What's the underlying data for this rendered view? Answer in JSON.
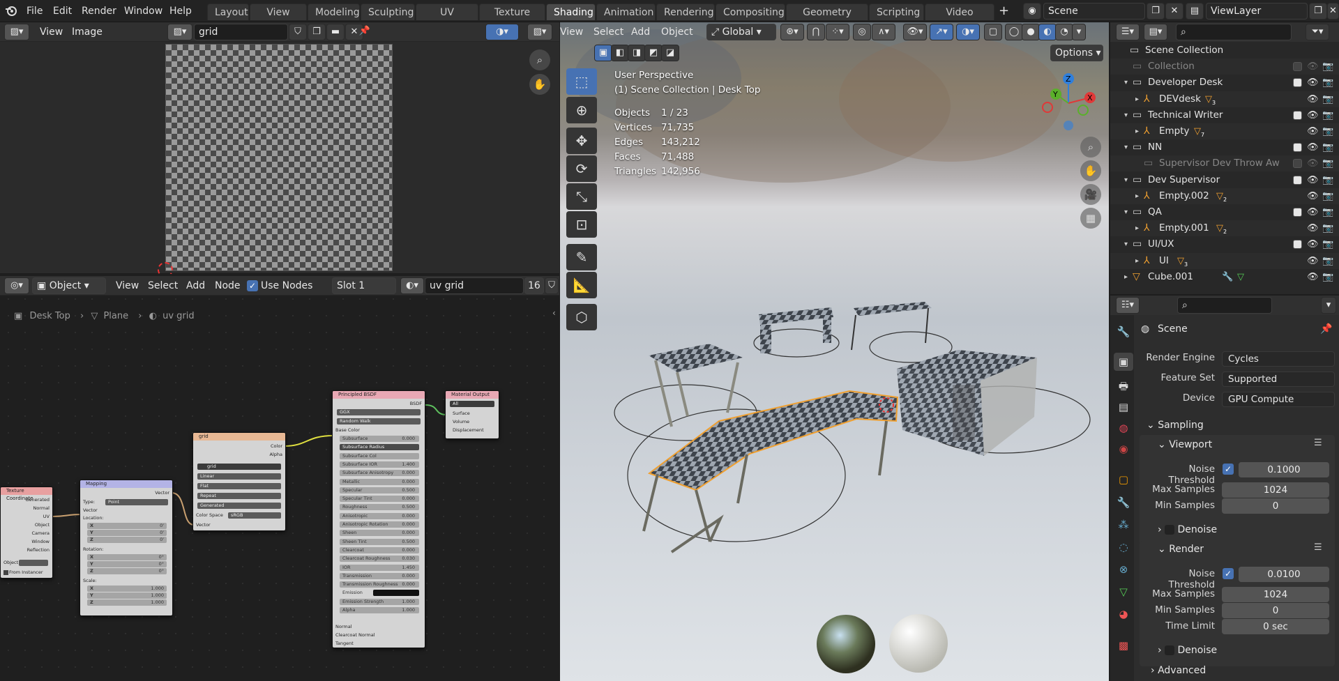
{
  "topbar": {
    "menus": [
      "File",
      "Edit",
      "Render",
      "Window",
      "Help"
    ],
    "workspaces": [
      "Layout",
      "View Port",
      "Modeling",
      "Sculpting",
      "UV Editing",
      "Texture Paint",
      "Shading",
      "Animation",
      "Rendering",
      "Compositing",
      "Geometry Nodes",
      "Scripting",
      "Video Editing"
    ],
    "active_workspace": "Shading",
    "add_tab": "+",
    "scene": "Scene",
    "view_layer": "ViewLayer"
  },
  "image_editor": {
    "menus": [
      "View",
      "Image"
    ],
    "image_name": "grid"
  },
  "node_editor": {
    "object_mode": "Object",
    "menus": [
      "View",
      "Select",
      "Add",
      "Node"
    ],
    "use_nodes_label": "Use Nodes",
    "slot": "Slot 1",
    "material": "uv grid",
    "user_count": "16",
    "breadcrumb": [
      "Desk Top",
      "Plane",
      "uv grid"
    ],
    "nodes": {
      "texcoord": {
        "title": "Texture Coordinate",
        "outputs": [
          "Generated",
          "Normal",
          "UV",
          "Object",
          "Camera",
          "Window",
          "Reflection"
        ],
        "object_label": "Object",
        "from_instancer": "From Instancer"
      },
      "mapping": {
        "title": "Mapping",
        "vector_out": "Vector",
        "type_label": "Type:",
        "type_value": "Point",
        "vector_in": "Vector",
        "location": "Location:",
        "rotation": "Rotation:",
        "scale": "Scale:",
        "x": "X",
        "y": "Y",
        "z": "Z",
        "loc": [
          "0'",
          "0'",
          "0'"
        ],
        "rot": [
          "0°",
          "0°",
          "0°"
        ],
        "scl": [
          "1.000",
          "1.000",
          "1.000"
        ]
      },
      "image": {
        "title": "grid",
        "color": "Color",
        "alpha": "Alpha",
        "image": "grid",
        "interp": "Linear",
        "proj": "Flat",
        "ext": "Repeat",
        "source": "Generated",
        "colorspace_label": "Color Space",
        "colorspace": "sRGB",
        "vector": "Vector"
      },
      "bsdf": {
        "title": "Principled BSDF",
        "out": "BSDF",
        "dist": "GGX",
        "sss_method": "Random Walk",
        "base_color": "Base Color",
        "rows": [
          [
            "Subsurface",
            "0.000"
          ],
          [
            "Subsurface Radius",
            ""
          ],
          [
            "Subsurface Col",
            ""
          ],
          [
            "Subsurface IOR",
            "1.400"
          ],
          [
            "Subsurface Anisotropy",
            "0.000"
          ],
          [
            "Metallic",
            "0.000"
          ],
          [
            "Specular",
            "0.500"
          ],
          [
            "Specular Tint",
            "0.000"
          ],
          [
            "Roughness",
            "0.500"
          ],
          [
            "Anisotropic",
            "0.000"
          ],
          [
            "Anisotropic Rotation",
            "0.000"
          ],
          [
            "Sheen",
            "0.000"
          ],
          [
            "Sheen Tint",
            "0.500"
          ],
          [
            "Clearcoat",
            "0.000"
          ],
          [
            "Clearcoat Roughness",
            "0.030"
          ],
          [
            "IOR",
            "1.450"
          ],
          [
            "Transmission",
            "0.000"
          ],
          [
            "Transmission Roughness",
            "0.000"
          ],
          [
            "Emission",
            ""
          ],
          [
            "Emission Strength",
            "1.000"
          ],
          [
            "Alpha",
            "1.000"
          ]
        ],
        "inputs_bottom": [
          "Normal",
          "Clearcoat Normal",
          "Tangent"
        ]
      },
      "output": {
        "title": "Material Output",
        "target": "All",
        "inputs": [
          "Surface",
          "Volume",
          "Displacement"
        ]
      }
    }
  },
  "viewport": {
    "menus": [
      "View",
      "Select",
      "Add",
      "Object"
    ],
    "orientation": "Global",
    "options": "Options",
    "perspective": "User Perspective",
    "context": "(1) Scene Collection | Desk Top",
    "stats": [
      {
        "label": "Objects",
        "value": "1 / 23"
      },
      {
        "label": "Vertices",
        "value": "71,735"
      },
      {
        "label": "Edges",
        "value": "143,212"
      },
      {
        "label": "Faces",
        "value": "71,488"
      },
      {
        "label": "Triangles",
        "value": "142,956"
      }
    ],
    "gizmo": {
      "x": "X",
      "y": "Y",
      "z": "Z"
    }
  },
  "outliner": {
    "rows": [
      {
        "label": "Scene Collection",
        "indent": 0,
        "type": "scene"
      },
      {
        "label": "Collection",
        "indent": 1,
        "type": "collection",
        "dim": true
      },
      {
        "label": "Developer Desk",
        "indent": 1,
        "type": "collection"
      },
      {
        "label": "DEVdesk",
        "indent": 2,
        "type": "empty",
        "badge": "3"
      },
      {
        "label": "Technical Writer",
        "indent": 1,
        "type": "collection"
      },
      {
        "label": "Empty",
        "indent": 2,
        "type": "empty",
        "badge": "7"
      },
      {
        "label": "NN",
        "indent": 1,
        "type": "collection"
      },
      {
        "label": "Supervisor Dev Throw Aw",
        "indent": 2,
        "type": "collection",
        "dim": true
      },
      {
        "label": "Dev Supervisor",
        "indent": 1,
        "type": "collection"
      },
      {
        "label": "Empty.002",
        "indent": 2,
        "type": "empty",
        "badge": "2"
      },
      {
        "label": "QA",
        "indent": 1,
        "type": "collection"
      },
      {
        "label": "Empty.001",
        "indent": 2,
        "type": "empty",
        "badge": "2"
      },
      {
        "label": "UI/UX",
        "indent": 1,
        "type": "collection"
      },
      {
        "label": "UI",
        "indent": 2,
        "type": "empty",
        "badge": "3"
      },
      {
        "label": "Cube.001",
        "indent": 1,
        "type": "mesh"
      }
    ]
  },
  "properties": {
    "context": "Scene",
    "render_engine_label": "Render Engine",
    "render_engine": "Cycles",
    "feature_set_label": "Feature Set",
    "feature_set": "Supported",
    "device_label": "Device",
    "device": "GPU Compute",
    "sampling": "Sampling",
    "viewport": "Viewport",
    "noise_threshold_label": "Noise Threshold",
    "vp_noise": "0.1000",
    "max_samples_label": "Max Samples",
    "vp_max": "1024",
    "min_samples_label": "Min Samples",
    "vp_min": "0",
    "denoise": "Denoise",
    "render": "Render",
    "r_noise": "0.0100",
    "r_max": "1024",
    "r_min": "0",
    "time_limit_label": "Time Limit",
    "r_time": "0 sec",
    "advanced": "Advanced"
  },
  "colors": {
    "accent": "#4772b3",
    "selected_outline": "#f0a030",
    "active_tab": "#4a4a4a"
  }
}
